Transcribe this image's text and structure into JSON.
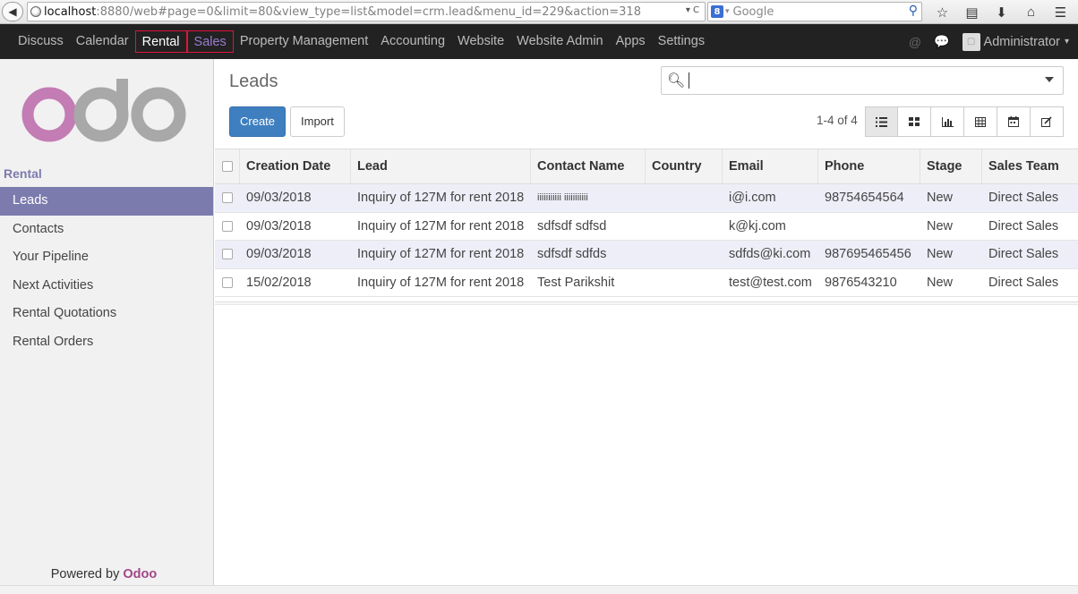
{
  "browser": {
    "url_host": "localhost",
    "url_rest": ":8880/web#page=0&limit=80&view_type=list&model=crm.lead&menu_id=229&action=318",
    "search_engine": "Google",
    "url_dropdown_glyph": "▾ C",
    "icons": [
      "star-icon",
      "bookmarks-icon",
      "download-icon",
      "home-icon",
      "menu-icon"
    ]
  },
  "topnav": {
    "items": [
      "Discuss",
      "Calendar",
      "Rental",
      "Sales",
      "Property Management",
      "Accounting",
      "Website",
      "Website Admin",
      "Apps",
      "Settings"
    ],
    "user": "Administrator",
    "icons": [
      "at-icon",
      "chat-icon"
    ]
  },
  "sidebar": {
    "logo_text": "odoo",
    "section": "Rental",
    "items": [
      "Leads",
      "Contacts",
      "Your Pipeline",
      "Next Activities",
      "Rental Quotations",
      "Rental Orders"
    ],
    "powered_prefix": "Powered by ",
    "powered_brand": "Odoo"
  },
  "main": {
    "title": "Leads",
    "create_label": "Create",
    "import_label": "Import",
    "pager": "1-4 of 4",
    "views": [
      "list-view-icon",
      "kanban-view-icon",
      "graph-view-icon",
      "pivot-view-icon",
      "calendar-view-icon",
      "form-view-icon"
    ]
  },
  "table": {
    "columns": [
      "Creation Date",
      "Lead",
      "Contact Name",
      "Country",
      "Email",
      "Phone",
      "Stage",
      "Sales Team"
    ],
    "rows": [
      [
        "09/03/2018",
        "Inquiry of 127M for rent 2018",
        "iiiiiiiiiii iiiiiiiiiii",
        "",
        "i@i.com",
        "98754654564",
        "New",
        "Direct Sales"
      ],
      [
        "09/03/2018",
        "Inquiry of 127M for rent 2018",
        "sdfsdf sdfsd",
        "",
        "k@kj.com",
        "",
        "New",
        "Direct Sales"
      ],
      [
        "09/03/2018",
        "Inquiry of 127M for rent 2018",
        "sdfsdf sdfds",
        "",
        "sdfds@ki.com",
        "987695465456",
        "New",
        "Direct Sales"
      ],
      [
        "15/02/2018",
        "Inquiry of 127M for rent 2018",
        "Test Parikshit",
        "",
        "test@test.com",
        "9876543210",
        "New",
        "Direct Sales"
      ]
    ]
  },
  "colors": {
    "accent": "#7c7bad",
    "primary_button": "#3f7fbf",
    "brand": "#a24689",
    "nav_bg": "#222222"
  }
}
